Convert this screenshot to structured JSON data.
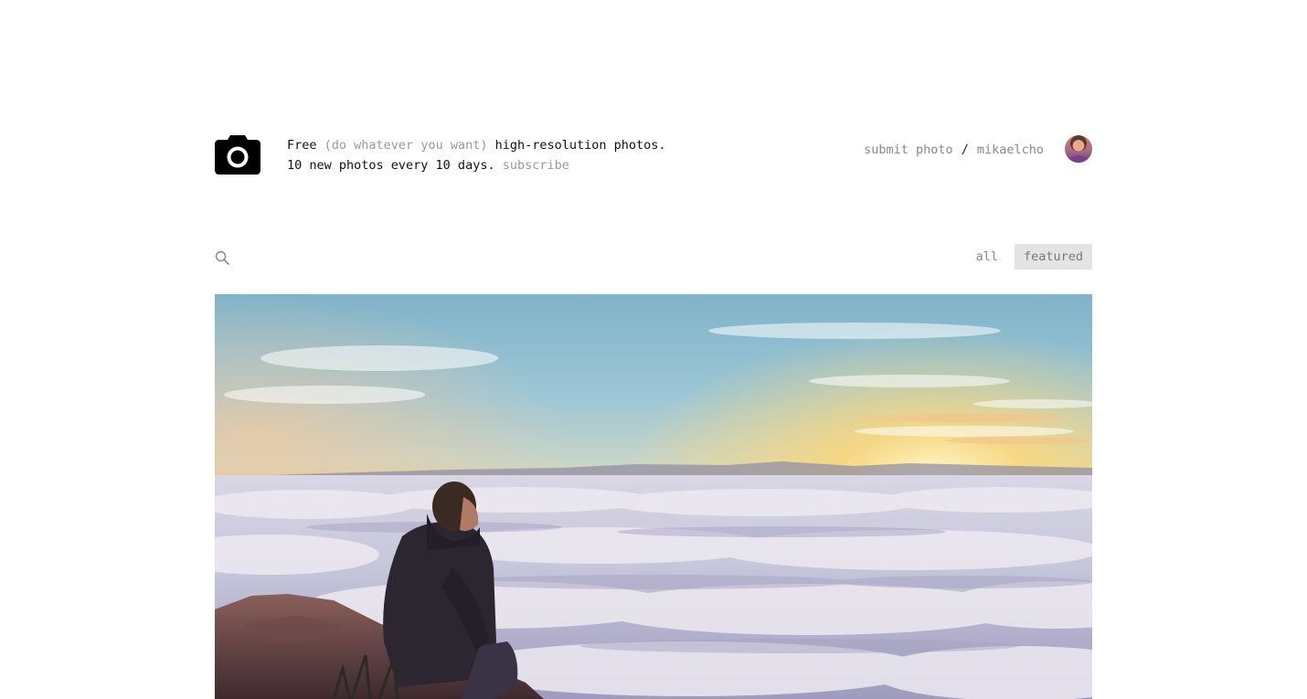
{
  "header": {
    "tagline": {
      "free": "Free",
      "aside": "(do whatever you want)",
      "rest": "high-resolution photos.",
      "line2": "10 new photos every 10 days.",
      "subscribe": "subscribe"
    },
    "nav": {
      "submit_photo": "submit photo",
      "separator": "/",
      "username": "mikaelcho"
    }
  },
  "filters": {
    "search_placeholder": "",
    "tabs": [
      {
        "label": "all",
        "active": false
      },
      {
        "label": "featured",
        "active": true
      }
    ]
  },
  "photo": {
    "description": "person sitting on rock looking over a sea of clouds at sunrise"
  },
  "icons": {
    "logo": "camera-icon",
    "search": "search-icon",
    "avatar": "avatar"
  },
  "colors": {
    "text": "#111111",
    "muted": "#999999",
    "active_tab_bg": "#e4e4e4"
  }
}
